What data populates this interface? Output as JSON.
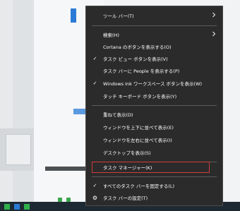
{
  "context_menu": {
    "items": [
      {
        "label": "ツール バー(T)",
        "checked": false,
        "submenu": true
      },
      {
        "label": "検索(H)",
        "checked": false,
        "submenu": true
      },
      {
        "label": "Cortana のボタンを表示する(O)",
        "checked": false,
        "submenu": false
      },
      {
        "label": "タスク ビュー ボタンを表示(V)",
        "checked": true,
        "submenu": false
      },
      {
        "label": "タスク バーに People を表示する(P)",
        "checked": false,
        "submenu": false
      },
      {
        "label": "Windows Ink ワークスペース ボタンを表示(W)",
        "checked": true,
        "submenu": false
      },
      {
        "label": "タッチ キーボード ボタンを表示(Y)",
        "checked": false,
        "submenu": false
      },
      {
        "label": "重ねて表示(D)",
        "checked": false,
        "submenu": false
      },
      {
        "label": "ウィンドウを上下に並べて表示(E)",
        "checked": false,
        "submenu": false
      },
      {
        "label": "ウィンドウを左右に並べて表示(I)",
        "checked": false,
        "submenu": false
      },
      {
        "label": "デスクトップを表示(S)",
        "checked": false,
        "submenu": false
      },
      {
        "label": "タスク マネージャー(K)",
        "checked": false,
        "submenu": false,
        "highlighted": true
      },
      {
        "label": "すべてのタスク バーを固定する(L)",
        "checked": true,
        "submenu": false
      },
      {
        "label": "タスク バーの設定(T)",
        "checked": false,
        "submenu": false,
        "icon": "gear-icon"
      }
    ],
    "check_glyph": "✓",
    "arrow_glyph": "›",
    "gear_glyph": "⚙",
    "colors": {
      "menu_bg": "#2b2b2b",
      "text": "#ffffff",
      "separator": "#5a5a5a",
      "highlight_border": "#d03c3c"
    }
  },
  "taskbar": {
    "icons": [
      "green-app-icon",
      "blue-app-icon",
      "green-app-icon"
    ]
  }
}
